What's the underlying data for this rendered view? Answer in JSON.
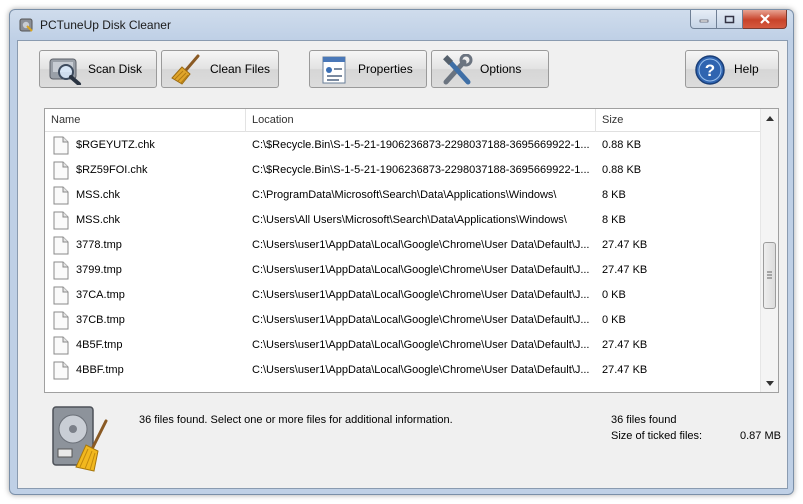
{
  "window": {
    "title": "PCTuneUp Disk Cleaner"
  },
  "toolbar": {
    "scan_label": "Scan Disk",
    "clean_label": "Clean Files",
    "properties_label": "Properties",
    "options_label": "Options",
    "help_label": "Help"
  },
  "columns": {
    "name": "Name",
    "location": "Location",
    "size": "Size"
  },
  "rows": [
    {
      "name": "$RGEYUTZ.chk",
      "location": "C:\\$Recycle.Bin\\S-1-5-21-1906236873-2298037188-3695669922-1...",
      "size": "0.88 KB"
    },
    {
      "name": "$RZ59FOI.chk",
      "location": "C:\\$Recycle.Bin\\S-1-5-21-1906236873-2298037188-3695669922-1...",
      "size": "0.88 KB"
    },
    {
      "name": "MSS.chk",
      "location": "C:\\ProgramData\\Microsoft\\Search\\Data\\Applications\\Windows\\",
      "size": "8 KB"
    },
    {
      "name": "MSS.chk",
      "location": "C:\\Users\\All Users\\Microsoft\\Search\\Data\\Applications\\Windows\\",
      "size": "8 KB"
    },
    {
      "name": "3778.tmp",
      "location": "C:\\Users\\user1\\AppData\\Local\\Google\\Chrome\\User Data\\Default\\J...",
      "size": "27.47 KB"
    },
    {
      "name": "3799.tmp",
      "location": "C:\\Users\\user1\\AppData\\Local\\Google\\Chrome\\User Data\\Default\\J...",
      "size": "27.47 KB"
    },
    {
      "name": "37CA.tmp",
      "location": "C:\\Users\\user1\\AppData\\Local\\Google\\Chrome\\User Data\\Default\\J...",
      "size": "0 KB"
    },
    {
      "name": "37CB.tmp",
      "location": "C:\\Users\\user1\\AppData\\Local\\Google\\Chrome\\User Data\\Default\\J...",
      "size": "0 KB"
    },
    {
      "name": "4B5F.tmp",
      "location": "C:\\Users\\user1\\AppData\\Local\\Google\\Chrome\\User Data\\Default\\J...",
      "size": "27.47 KB"
    },
    {
      "name": "4BBF.tmp",
      "location": "C:\\Users\\user1\\AppData\\Local\\Google\\Chrome\\User Data\\Default\\J...",
      "size": "27.47 KB"
    }
  ],
  "status": {
    "message": "36 files found. Select one or more files for additional information.",
    "files_found": "36 files found",
    "ticked_label": "Size of ticked files:",
    "ticked_value": "0.87 MB"
  },
  "icons": {
    "app": "disk-cleaner-icon",
    "scan": "magnifier-disk-icon",
    "clean": "broom-icon",
    "properties": "properties-sheet-icon",
    "options": "tools-icon",
    "help": "help-question-icon",
    "file": "file-icon",
    "status": "disk-broom-icon"
  },
  "colors": {
    "accent": "#3a6fb5",
    "close": "#c8432a",
    "title_bar": "#bfd0e6"
  }
}
